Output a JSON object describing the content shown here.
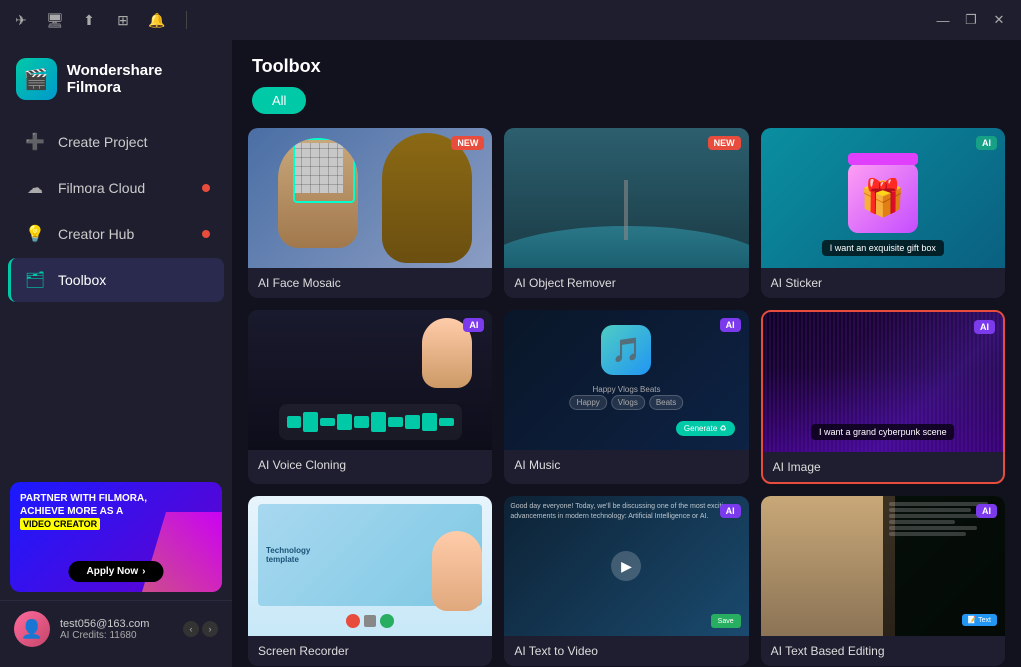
{
  "app": {
    "title": "Wondershare Filmora",
    "logo_emoji": "🎬"
  },
  "titlebar": {
    "icons": [
      "send-icon",
      "monitor-icon",
      "upload-icon",
      "grid-icon",
      "bell-icon"
    ],
    "minimize_label": "—",
    "restore_label": "❐",
    "close_label": "✕",
    "separator": "|"
  },
  "sidebar": {
    "logo_text_line1": "Wondershare",
    "logo_text_line2": "Filmora",
    "nav_items": [
      {
        "id": "create-project",
        "label": "Create Project",
        "icon": "➕",
        "active": false,
        "dot": false
      },
      {
        "id": "filmora-cloud",
        "label": "Filmora Cloud",
        "icon": "☁",
        "active": false,
        "dot": true
      },
      {
        "id": "creator-hub",
        "label": "Creator Hub",
        "icon": "💡",
        "active": false,
        "dot": true
      },
      {
        "id": "toolbox",
        "label": "Toolbox",
        "icon": "🗂",
        "active": true,
        "dot": false
      }
    ],
    "banner": {
      "line1": "PARTNER WITH FILMORA,",
      "line2": "ACHIEVE MORE AS A",
      "highlight": "VIDEO CREATOR",
      "btn_label": "Apply Now"
    },
    "user": {
      "email": "test056@163.com",
      "credits_label": "AI Credits: 11680"
    }
  },
  "content": {
    "title": "Toolbox",
    "tabs": [
      {
        "id": "all",
        "label": "All",
        "active": true
      }
    ],
    "tools": [
      {
        "id": "ai-face-mosaic",
        "name": "AI Face Mosaic",
        "type": "face-mosaic",
        "badge": "NEW",
        "badge_type": "new",
        "selected": false
      },
      {
        "id": "ai-object-remover",
        "name": "AI Object Remover",
        "type": "obj-remover",
        "badge": "NEW",
        "badge_type": "new",
        "selected": false
      },
      {
        "id": "ai-sticker",
        "name": "AI Sticker",
        "type": "sticker",
        "badge": "AI",
        "badge_type": "ai",
        "prompt": "I want an exquisite gift box",
        "selected": false
      },
      {
        "id": "ai-voice-cloning",
        "name": "AI Voice Cloning",
        "type": "voice-cloning",
        "badge": "AI",
        "badge_type": "ai",
        "selected": false
      },
      {
        "id": "ai-music",
        "name": "AI Music",
        "type": "music",
        "badge": "AI",
        "badge_type": "ai",
        "tags": [
          "Happy",
          "Vlogs",
          "Beats"
        ],
        "generate_label": "Generate",
        "selected": false
      },
      {
        "id": "ai-image",
        "name": "AI Image",
        "type": "image",
        "badge": "AI",
        "badge_type": "ai",
        "prompt": "I want a grand cyberpunk scene",
        "selected": true
      },
      {
        "id": "screen-recorder",
        "name": "Screen Recorder",
        "type": "screen-recorder",
        "badge": null,
        "selected": false
      },
      {
        "id": "ai-text-to-video",
        "name": "AI Text to Video",
        "type": "text-to-video",
        "badge": "AI",
        "badge_type": "ai",
        "selected": false
      },
      {
        "id": "ai-text-based-editing",
        "name": "AI Text Based Editing",
        "type": "text-based-editing",
        "badge": "AI",
        "badge_type": "ai",
        "text_btn": "Text",
        "selected": false
      }
    ]
  }
}
